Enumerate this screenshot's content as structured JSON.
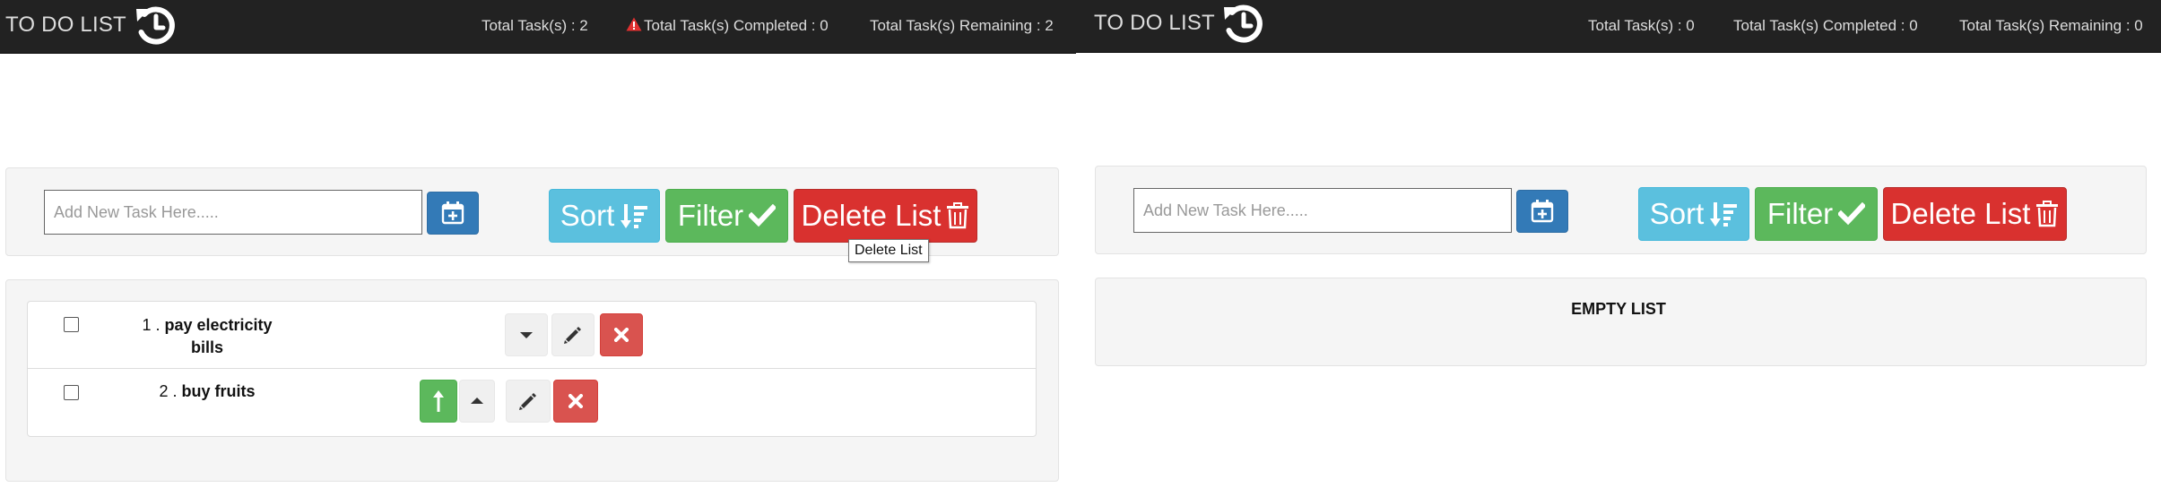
{
  "left": {
    "navbar": {
      "brand": "TO DO LIST",
      "reset_icon": "history-reset-icon",
      "total_tasks": "Total Task(s) : 2",
      "total_completed": "Total Task(s) Completed : 0",
      "total_remaining": "Total Task(s) Remaining : 2",
      "warning_icon": "warning-triangle-icon",
      "warning_color": "#e03030"
    },
    "controls": {
      "input_placeholder": "Add New Task Here.....",
      "input_value": "",
      "add_icon": "calendar-plus-icon",
      "sort_label": "Sort",
      "sort_icon": "sort-amount-desc-icon",
      "filter_label": "Filter",
      "filter_icon": "check-icon",
      "delete_label": "Delete List",
      "delete_icon": "trash-icon",
      "tooltip": "Delete List"
    },
    "tasks": [
      {
        "number": "1 .",
        "text_line1": "pay electricity",
        "text_line2": "bills",
        "completed": false,
        "actions": [
          "move-down",
          "edit",
          "delete"
        ]
      },
      {
        "number": "2 .",
        "text": "buy fruits",
        "completed": false,
        "actions": [
          "move-top",
          "move-up",
          "edit",
          "delete"
        ]
      }
    ]
  },
  "right": {
    "navbar": {
      "brand": "TO DO LIST",
      "reset_icon": "history-reset-icon",
      "total_tasks": "Total Task(s) : 0",
      "total_completed": "Total Task(s) Completed : 0",
      "total_remaining": "Total Task(s) Remaining : 0"
    },
    "controls": {
      "input_placeholder": "Add New Task Here.....",
      "input_value": "",
      "add_icon": "calendar-plus-icon",
      "sort_label": "Sort",
      "sort_icon": "sort-amount-desc-icon",
      "filter_label": "Filter",
      "filter_icon": "check-icon",
      "delete_label": "Delete List",
      "delete_icon": "trash-icon"
    },
    "empty_message": "EMPTY LIST"
  },
  "colors": {
    "navbar_bg": "#222222",
    "primary": "#337ab7",
    "info": "#5bc0de",
    "success": "#5cb85c",
    "danger": "#d9312f"
  }
}
